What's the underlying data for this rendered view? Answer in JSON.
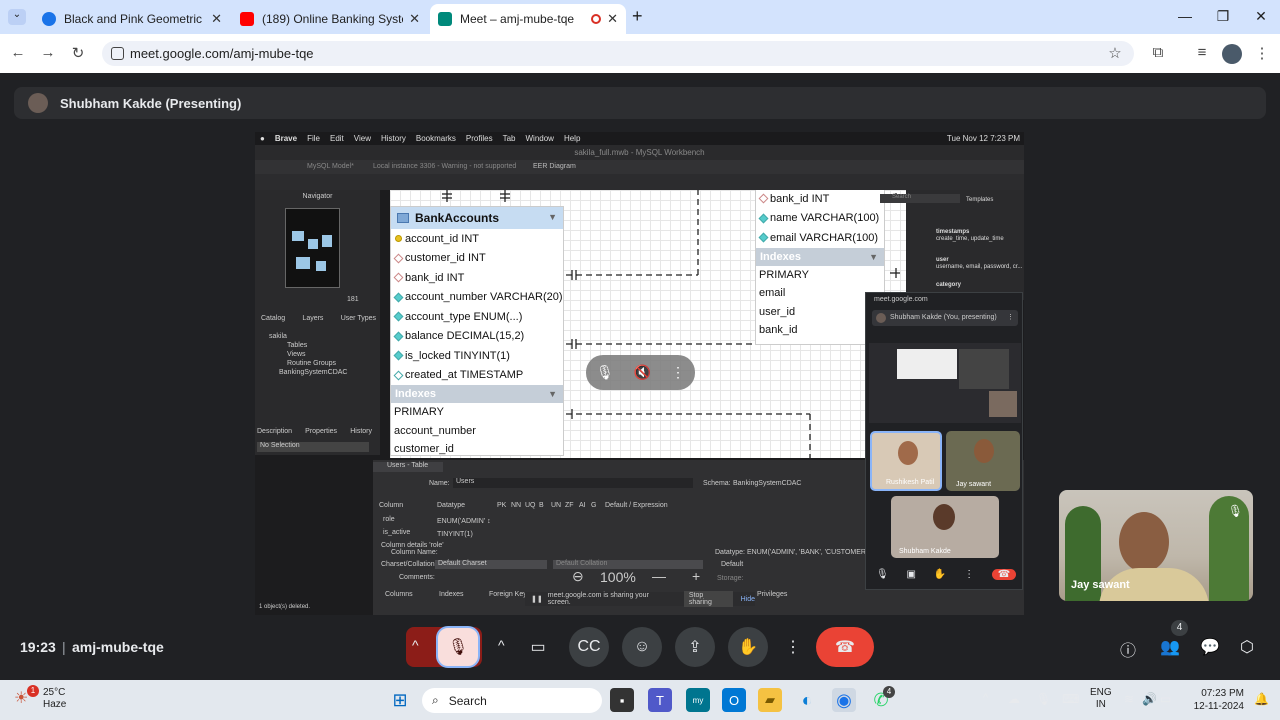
{
  "browser": {
    "tabs": [
      {
        "title": "Black and Pink Geometric Busin",
        "color": "#1a73e8"
      },
      {
        "title": "(189) Online Banking System Pr",
        "color": "#ff0000"
      },
      {
        "title": "Meet – amj-mube-tqe",
        "color": "#00897b"
      }
    ],
    "url": "meet.google.com/amj-mube-tqe"
  },
  "meet": {
    "presenter_label": "Shubham Kakde (Presenting)",
    "time": "19:23",
    "meeting_code": "amj-mube-tqe",
    "participant_count": "4"
  },
  "shared_screen": {
    "mac_menu": [
      "Brave",
      "File",
      "Edit",
      "View",
      "History",
      "Bookmarks",
      "Profiles",
      "Tab",
      "Window",
      "Help"
    ],
    "mac_clock": "Tue Nov 12  7:23 PM",
    "window_title": "sakila_full.mwb - MySQL Workbench",
    "wb_tabs": [
      "MySQL Model*",
      "Local instance 3306 - Warning - not supported",
      "EER Diagram"
    ],
    "navigator_label": "Navigator",
    "zoom_small": "181",
    "nav_tabs": [
      "Catalog",
      "Layers",
      "User Types"
    ],
    "schema_tree": [
      "sakila",
      "Tables",
      "Views",
      "Routine Groups",
      "BankingSystemCDAC"
    ],
    "desc_tabs": [
      "Description",
      "Properties",
      "History"
    ],
    "no_selection": "No Selection",
    "status": "1 object(s) deleted.",
    "search_placeholder": "Search",
    "templates_label": "Templates",
    "templates": [
      {
        "name": "timestamps",
        "desc": "create_time, update_time"
      },
      {
        "name": "user",
        "desc": "username, email, password, cr..."
      },
      {
        "name": "category",
        "desc": ""
      }
    ],
    "bank_accounts": {
      "title": "BankAccounts",
      "columns": [
        "account_id INT",
        "customer_id INT",
        "bank_id INT",
        "account_number VARCHAR(20)",
        "account_type ENUM(...)",
        "balance DECIMAL(15,2)",
        "is_locked TINYINT(1)",
        "created_at TIMESTAMP"
      ],
      "indexes_label": "Indexes",
      "indexes": [
        "PRIMARY",
        "account_number",
        "customer_id"
      ]
    },
    "other_table": {
      "columns": [
        "bank_id INT",
        "name VARCHAR(100)",
        "email VARCHAR(100)"
      ],
      "indexes_label": "Indexes",
      "indexes": [
        "PRIMARY",
        "email",
        "user_id",
        "bank_id"
      ]
    },
    "editor": {
      "tab": "Users - Table",
      "name_label": "Name:",
      "name_value": "Users",
      "schema_label": "Schema:",
      "schema_value": "BankingSystemCDAC",
      "col_headers": [
        "Column",
        "Datatype",
        "PK",
        "NN",
        "UQ",
        "B",
        "UN",
        "ZF",
        "AI",
        "G",
        "Default / Expression"
      ],
      "rows": [
        {
          "col": "role",
          "type": "ENUM('ADMIN' ↕"
        },
        {
          "col": "is_active",
          "type": "TINYINT(1)"
        }
      ],
      "details_label": "Column details 'role'",
      "column_name_label": "Column Name:",
      "charset_label": "Charset/Collation:",
      "charset_value": "Default Charset",
      "collation_value": "Default Collation",
      "comments_label": "Comments:",
      "datatype_label": "Datatype:",
      "datatype_value": "ENUM('ADMIN', 'BANK', 'CUSTOMER')",
      "default_label": "Default",
      "storage_label": "Storage:",
      "bottom_tabs": [
        "Columns",
        "Indexes",
        "Foreign Keys",
        "Privileges"
      ]
    },
    "zoom_level": "100%",
    "share_notice": "meet.google.com is sharing your screen.",
    "stop_sharing": "Stop sharing",
    "hide": "Hide"
  },
  "selfview": {
    "url": "meet.google.com",
    "header": "Shubham Kakde (You, presenting)",
    "tiles": [
      "Rushikesh Patil",
      "Jay sawant",
      "Shubham Kakde"
    ]
  },
  "jay_tile": {
    "name": "Jay sawant"
  },
  "taskbar": {
    "weather_temp": "25°C",
    "weather_desc": "Haze",
    "search_label": "Search",
    "lang": "ENG",
    "region": "IN",
    "clock_time": "07:23 PM",
    "clock_date": "12-11-2024",
    "weather_badge": "1",
    "whatsapp_badge": "4"
  }
}
